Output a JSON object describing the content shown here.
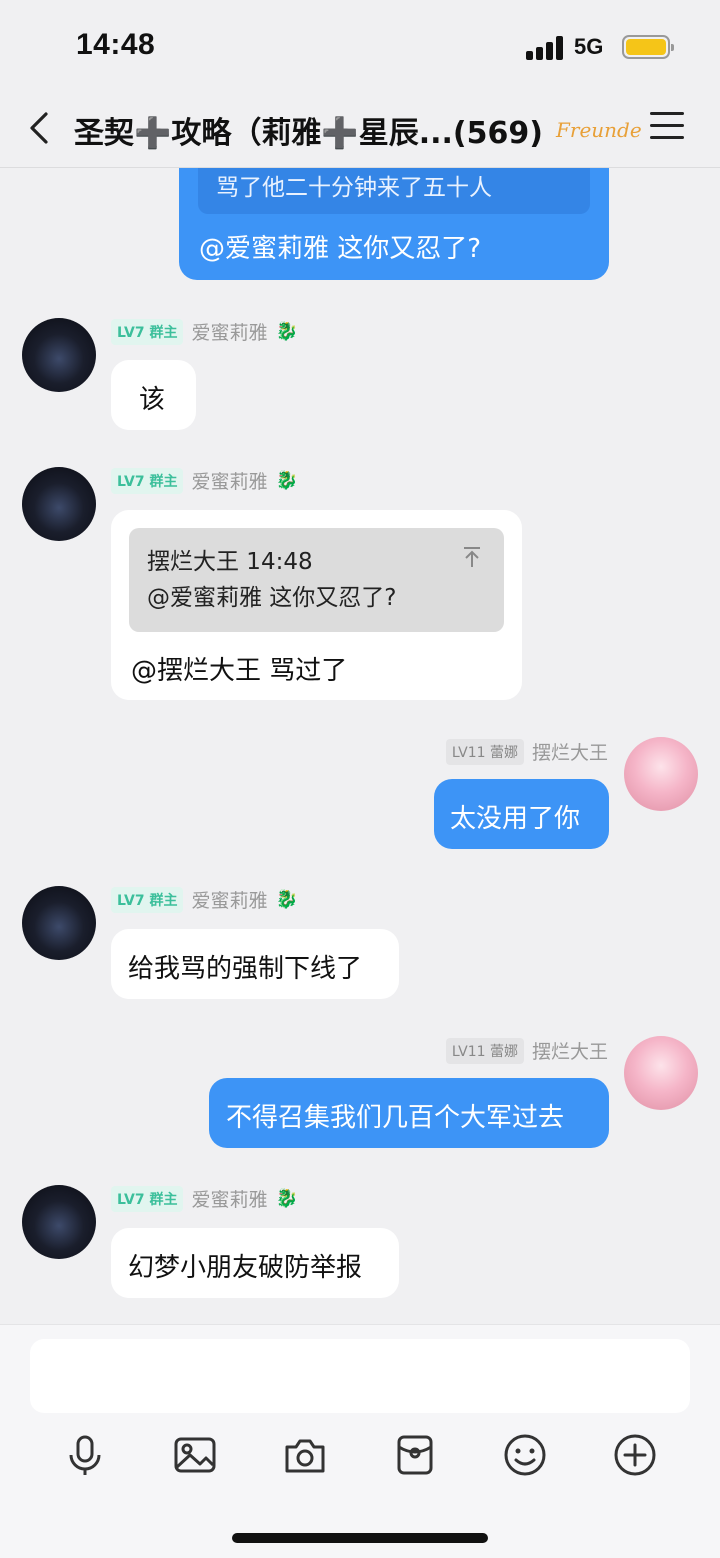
{
  "status_bar": {
    "time": "14:48",
    "network": "5G"
  },
  "header": {
    "title": "圣契➕攻略（莉雅➕星辰...(569)",
    "decoration": "Freunde"
  },
  "messages": [
    {
      "sender": "摆烂大王",
      "side": "right",
      "quote_text": "骂了他二十分钟来了五十人",
      "text": "@爱蜜莉雅 这你又忍了?"
    },
    {
      "sender": "爱蜜莉雅",
      "side": "left",
      "level": "LV7",
      "role": "群主",
      "text": "该"
    },
    {
      "sender": "爱蜜莉雅",
      "side": "left",
      "level": "LV7",
      "role": "群主",
      "quote_header": "摆烂大王 14:48",
      "quote_text": "@爱蜜莉雅 这你又忍了?",
      "text": "@摆烂大王 骂过了"
    },
    {
      "sender": "摆烂大王",
      "side": "right",
      "level": "LV11",
      "role": "蕾娜",
      "text": "太没用了你"
    },
    {
      "sender": "爱蜜莉雅",
      "side": "left",
      "level": "LV7",
      "role": "群主",
      "text": "给我骂的强制下线了"
    },
    {
      "sender": "摆烂大王",
      "side": "right",
      "level": "LV11",
      "role": "蕾娜",
      "text": "不得召集我们几百个大军过去"
    },
    {
      "sender": "爱蜜莉雅",
      "side": "left",
      "level": "LV7",
      "role": "群主",
      "text": "幻梦小朋友破防举报"
    }
  ],
  "toolbar": [
    "mic-icon",
    "image-icon",
    "camera-icon",
    "red-packet-icon",
    "emoji-icon",
    "plus-icon"
  ],
  "colors": {
    "bubble_blue": "#3d94f6",
    "background": "#f0f0f2",
    "level_badge": "#3bbf9b"
  }
}
